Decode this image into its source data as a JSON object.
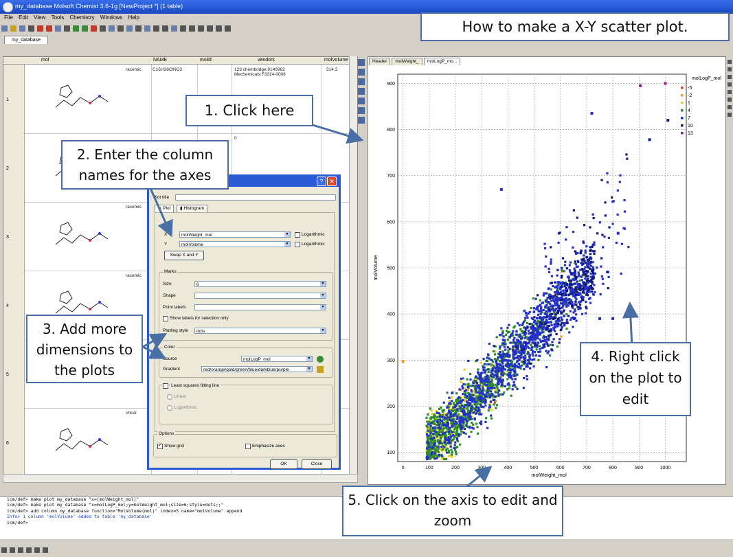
{
  "window": {
    "title": "my_database Molsoft Chemist 3.6-1g [NewProject *] (1 table)"
  },
  "menu": [
    "File",
    "Edit",
    "View",
    "Tools",
    "Chemistry",
    "Windows",
    "Help"
  ],
  "db_tab": "my_database",
  "table": {
    "columns": [
      "mol",
      "NAME",
      "molid",
      "vendors",
      "molVolume"
    ],
    "rows": [
      {
        "num": "1",
        "label": "racemic",
        "name": "C16H28ClNO2",
        "molid": "",
        "vendors": "129 chembridge:9140962\nMechemicals:F3314-0008",
        "volume": "314.3"
      },
      {
        "num": "2",
        "label": "",
        "name": "",
        "molid": "",
        "vendors": "0",
        "volume": ""
      },
      {
        "num": "3",
        "label": "racemic",
        "name": "",
        "molid": "",
        "vendors": "",
        "volume": ""
      },
      {
        "num": "4",
        "label": "racemic",
        "name": "",
        "molid": "",
        "vendors": "",
        "volume": ""
      },
      {
        "num": "5",
        "label": "",
        "name": "",
        "molid": "",
        "vendors": "",
        "volume": ""
      },
      {
        "num": "6",
        "label": "chiral",
        "name": "",
        "molid": "",
        "vendors": "",
        "volume": ""
      }
    ]
  },
  "plot_tabs": [
    "Header",
    "molWeight_",
    "molLogP_mo..."
  ],
  "dialog": {
    "plot_title_label": "Plot title",
    "tab_plot": "Plot",
    "tab_histogram": "Histogram",
    "x_label": "X",
    "x_value": "molWeight_mol",
    "y_label": "Y",
    "y_value": "molVolume",
    "logarithmic": "Logarithmic",
    "swap_button": "Swap X and Y",
    "marks_group": "Marks",
    "size_label": "Size",
    "size_value": "6",
    "shape_label": "Shape",
    "point_labels_label": "Point labels",
    "show_labels_selection": "Show labels for selection only",
    "plotting_style_label": "Plotting style",
    "plotting_style_value": "dots",
    "color_group": "Color",
    "source_label": "Source",
    "source_value": "molLogP_mol",
    "gradient_label": "Gradient",
    "gradient_value": "red/orange/gold/green/blue/darkblue/purple",
    "least_squares": "Least squares fitting line",
    "linear": "Linear",
    "logarithmic_fit": "Logarithmic",
    "options_group": "Options",
    "show_grid": "Show grid",
    "emphasize_axes": "Emphasize axes",
    "ok": "OK",
    "close": "Close"
  },
  "console": [
    "icm/def> make plot my_database \"x=[molWeight_mol]\"",
    "icm/def> make plot my_database \"x=molLogP_mol;y=molWeight_mol;size=6;style=dots;;\"",
    "icm/def> add column my_database function=\"MolVolume(mol)\" index=5 name=\"molVolume\" append",
    " Info> 1 column  'molVolume' added to table 'my_database'",
    "icm/def> "
  ],
  "callouts": {
    "title": "How to make a X-Y scatter plot.",
    "c1": "1. Click here",
    "c2": "2. Enter the column names for the axes",
    "c3": "3. Add more dimensions to the plots",
    "c4": "4. Right click on the plot to edit",
    "c5": "5. Click on the axis to edit and zoom"
  },
  "chart_data": {
    "type": "scatter",
    "xlabel": "molWeight_mol",
    "ylabel": "molVolume",
    "xlim": [
      -20,
      1080
    ],
    "ylim": [
      80,
      920
    ],
    "xticks": [
      0,
      100,
      200,
      300,
      400,
      500,
      600,
      700,
      800,
      900,
      1000
    ],
    "yticks": [
      100,
      200,
      300,
      400,
      500,
      600,
      700,
      800,
      900
    ],
    "grid": true,
    "legend_title": "molLogP_mol",
    "legend_position": "top-right",
    "series": [
      {
        "name": "-5",
        "color": "#e8332a"
      },
      {
        "name": "-2",
        "color": "#f0a21e"
      },
      {
        "name": "1",
        "color": "#e3d21c"
      },
      {
        "name": "4",
        "color": "#2e8b2e"
      },
      {
        "name": "7",
        "color": "#2431c8"
      },
      {
        "name": "10",
        "color": "#101a7a"
      },
      {
        "name": "13",
        "color": "#8a1a8a"
      }
    ],
    "trend": {
      "slope": 0.62,
      "intercept": 46
    },
    "sample_points": [
      {
        "x": 905,
        "y": 895,
        "series": "13"
      },
      {
        "x": 1000,
        "y": 900,
        "series": "13"
      },
      {
        "x": 1010,
        "y": 820,
        "series": "10"
      },
      {
        "x": 940,
        "y": 778,
        "series": "10"
      },
      {
        "x": 820,
        "y": 575,
        "series": "7"
      },
      {
        "x": 720,
        "y": 835,
        "series": "7"
      },
      {
        "x": 375,
        "y": 670,
        "series": "7"
      },
      {
        "x": 0,
        "y": 297,
        "series": "-2"
      },
      {
        "x": 750,
        "y": 390,
        "series": "7"
      },
      {
        "x": 800,
        "y": 390,
        "series": "7"
      }
    ]
  }
}
